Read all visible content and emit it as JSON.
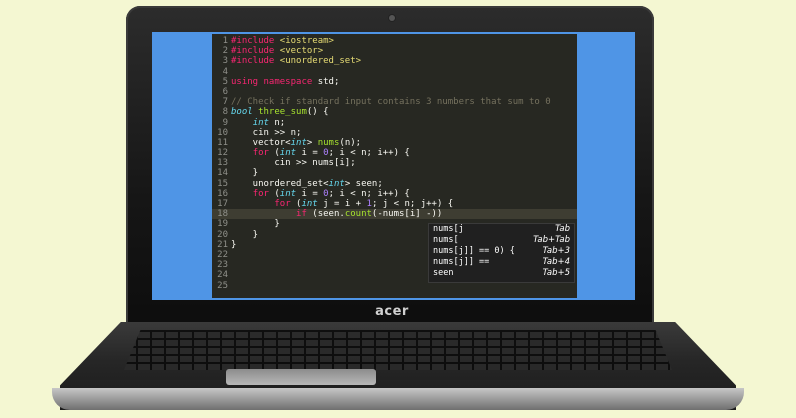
{
  "brand": "acer",
  "editor": {
    "active_line": 18,
    "lines": [
      {
        "n": "1",
        "tokens": [
          [
            "pp",
            "#include "
          ],
          [
            "str",
            "<iostream>"
          ]
        ]
      },
      {
        "n": "2",
        "tokens": [
          [
            "pp",
            "#include "
          ],
          [
            "str",
            "<vector>"
          ]
        ]
      },
      {
        "n": "3",
        "tokens": [
          [
            "pp",
            "#include "
          ],
          [
            "str",
            "<unordered_set>"
          ]
        ]
      },
      {
        "n": "4",
        "tokens": []
      },
      {
        "n": "5",
        "tokens": [
          [
            "kw",
            "using namespace "
          ],
          [
            "ns",
            "std;"
          ]
        ]
      },
      {
        "n": "6",
        "tokens": []
      },
      {
        "n": "7",
        "tokens": [
          [
            "cmt",
            "// Check if standard input contains 3 numbers that sum to 0"
          ]
        ]
      },
      {
        "n": "8",
        "tokens": [
          [
            "type",
            "bool "
          ],
          [
            "fn",
            "three_sum"
          ],
          [
            "ns",
            "() {"
          ]
        ]
      },
      {
        "n": "9",
        "tokens": [
          [
            "ns",
            "    "
          ],
          [
            "type",
            "int"
          ],
          [
            "ns",
            " n;"
          ]
        ]
      },
      {
        "n": "10",
        "tokens": [
          [
            "ns",
            "    cin >> n;"
          ]
        ]
      },
      {
        "n": "11",
        "tokens": [
          [
            "ns",
            "    vector<"
          ],
          [
            "type",
            "int"
          ],
          [
            "ns",
            "> "
          ],
          [
            "fn",
            "nums"
          ],
          [
            "ns",
            "(n);"
          ]
        ]
      },
      {
        "n": "12",
        "tokens": [
          [
            "ns",
            "    "
          ],
          [
            "kw",
            "for"
          ],
          [
            "ns",
            " ("
          ],
          [
            "type",
            "int"
          ],
          [
            "ns",
            " i = "
          ],
          [
            "num",
            "0"
          ],
          [
            "ns",
            "; i < n; i++) {"
          ]
        ]
      },
      {
        "n": "13",
        "tokens": [
          [
            "ns",
            "        cin >> nums[i];"
          ]
        ]
      },
      {
        "n": "14",
        "tokens": [
          [
            "ns",
            "    }"
          ]
        ]
      },
      {
        "n": "15",
        "tokens": [
          [
            "ns",
            "    unordered_set<"
          ],
          [
            "type",
            "int"
          ],
          [
            "ns",
            "> seen;"
          ]
        ]
      },
      {
        "n": "16",
        "tokens": [
          [
            "ns",
            "    "
          ],
          [
            "kw",
            "for"
          ],
          [
            "ns",
            " ("
          ],
          [
            "type",
            "int"
          ],
          [
            "ns",
            " i = "
          ],
          [
            "num",
            "0"
          ],
          [
            "ns",
            "; i < n; i++) {"
          ]
        ]
      },
      {
        "n": "17",
        "tokens": [
          [
            "ns",
            "        "
          ],
          [
            "kw",
            "for"
          ],
          [
            "ns",
            " ("
          ],
          [
            "type",
            "int"
          ],
          [
            "ns",
            " j = i + "
          ],
          [
            "num",
            "1"
          ],
          [
            "ns",
            "; j < n; j++) {"
          ]
        ]
      },
      {
        "n": "18",
        "tokens": [
          [
            "ns",
            "            "
          ],
          [
            "kw",
            "if"
          ],
          [
            "ns",
            " (seen."
          ],
          [
            "fn",
            "count"
          ],
          [
            "ns",
            "(-nums[i] -))"
          ]
        ]
      },
      {
        "n": "19",
        "tokens": [
          [
            "ns",
            "        }"
          ]
        ]
      },
      {
        "n": "20",
        "tokens": [
          [
            "ns",
            "    }"
          ]
        ]
      },
      {
        "n": "21",
        "tokens": [
          [
            "ns",
            "}"
          ]
        ]
      },
      {
        "n": "22",
        "tokens": []
      },
      {
        "n": "23",
        "tokens": []
      },
      {
        "n": "24",
        "tokens": []
      },
      {
        "n": "25",
        "tokens": []
      }
    ]
  },
  "autocomplete": [
    {
      "text": "nums[j",
      "key": "Tab"
    },
    {
      "text": "nums[",
      "key": "Tab+Tab"
    },
    {
      "text": "nums[j]] == 0) {",
      "key": "Tab+3"
    },
    {
      "text": "nums[j]] ==",
      "key": "Tab+4"
    },
    {
      "text": "seen",
      "key": "Tab+5"
    }
  ]
}
